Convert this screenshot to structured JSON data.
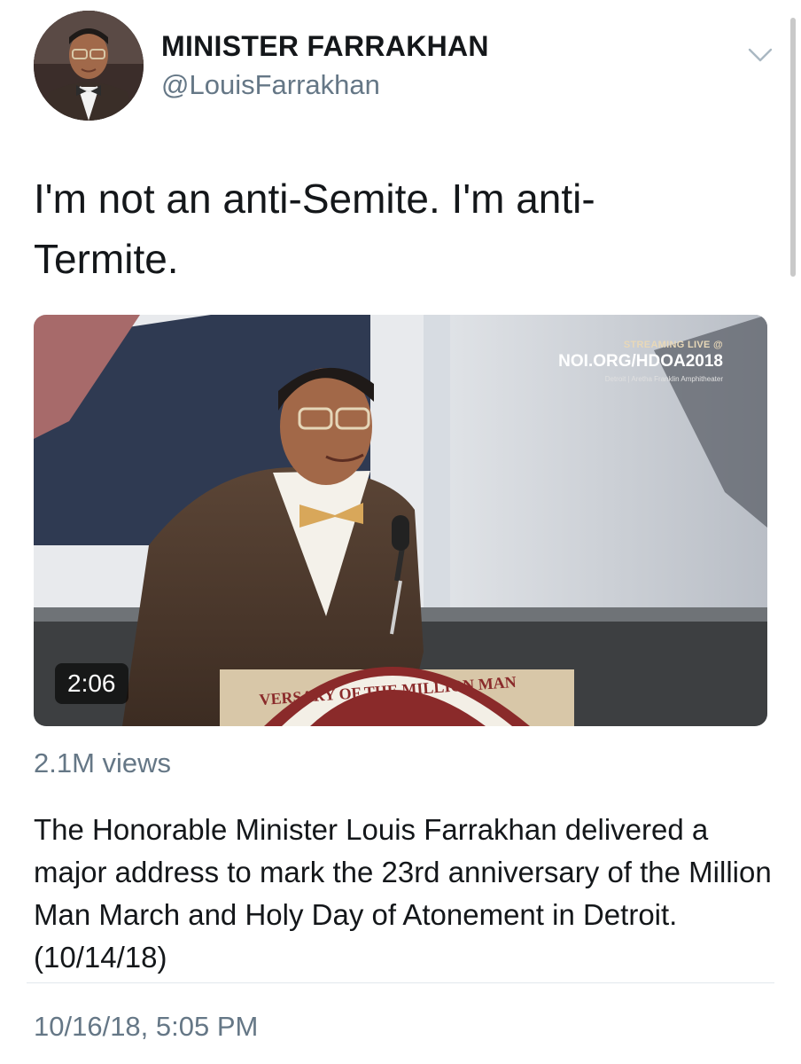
{
  "author": {
    "name": "MINISTER FARRAKHAN",
    "handle": "@LouisFarrakhan"
  },
  "tweet": {
    "text": "I'm not an anti-Semite. I'm anti-Termite."
  },
  "video": {
    "duration": "2:06",
    "overlay": {
      "label": "STREAMING LIVE @",
      "url": "NOI.ORG/HDOA2018",
      "venue": "Detroit | Aretha Franklin Amphitheater"
    },
    "podium_text": "VERSARY OF THE MILLION MAN"
  },
  "stats": {
    "views": "2.1M views"
  },
  "description": "The Honorable Minister Louis Farrakhan delivered a major address to mark the 23rd anniversary of the Million Man March and Holy Day of Atonement in Detroit. (10/14/18)",
  "timestamp": "10/16/18, 5:05 PM",
  "icons": {
    "menu": "chevron-down-icon",
    "avatar": "profile-photo"
  },
  "colors": {
    "text": "#14171a",
    "secondary": "#657786",
    "divider": "#e1e8ed"
  }
}
